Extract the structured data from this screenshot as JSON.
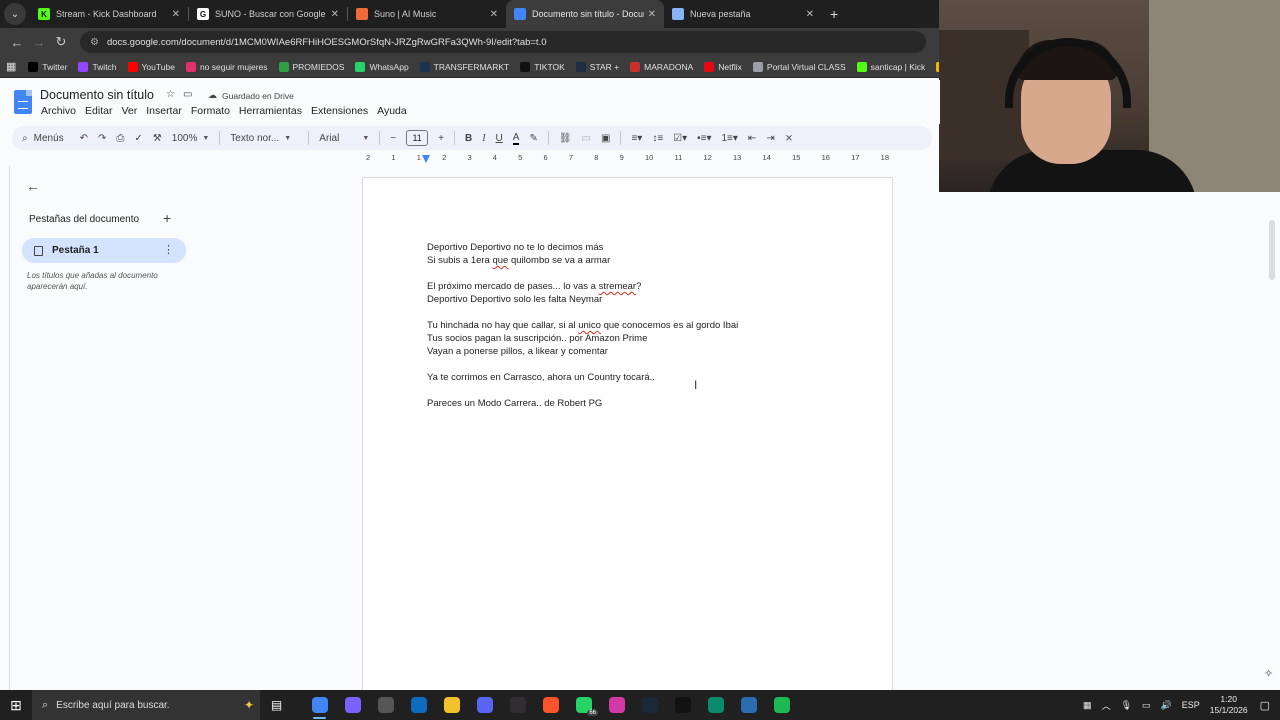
{
  "browser": {
    "tabs": [
      {
        "title": "Stream - Kick Dashboard",
        "favicon_color": "#53fc18",
        "favicon_glyph": "K",
        "active": false
      },
      {
        "title": "SUNO - Buscar con Google",
        "favicon_color": "#ffffff",
        "favicon_glyph": "G",
        "active": false
      },
      {
        "title": "Suno | AI Music",
        "favicon_color": "#f06a3c",
        "favicon_glyph": "",
        "active": false
      },
      {
        "title": "Documento sin título - Docume",
        "favicon_color": "#4285f4",
        "favicon_glyph": "",
        "active": true
      },
      {
        "title": "Nueva pestaña",
        "favicon_color": "#8ab4f8",
        "favicon_glyph": "",
        "active": false
      }
    ],
    "url": "docs.google.com/document/d/1MCM0WIAe6RFHiHOESGMOrSfqN-JRZgRwGRFa3QWh-9I/edit?tab=t.0",
    "bookmarks": [
      {
        "label": "Twitter",
        "color": "#000000"
      },
      {
        "label": "Twitch",
        "color": "#9146ff"
      },
      {
        "label": "YouTube",
        "color": "#ff0000"
      },
      {
        "label": "no seguir mujeres",
        "color": "#e1306c"
      },
      {
        "label": "PROMIEDOS",
        "color": "#2e9e44"
      },
      {
        "label": "WhatsApp",
        "color": "#25d366"
      },
      {
        "label": "TRANSFERMARKT",
        "color": "#1a3151"
      },
      {
        "label": "TIKTOK",
        "color": "#111111"
      },
      {
        "label": "STAR +",
        "color": "#1f2a44"
      },
      {
        "label": "MARADONA",
        "color": "#c4302b"
      },
      {
        "label": "Netflix",
        "color": "#e50914"
      },
      {
        "label": "Portal Virtual CLASS",
        "color": "#9aa0a6"
      },
      {
        "label": "santicap | Kick",
        "color": "#53fc18"
      },
      {
        "label": "UDE",
        "color": "#f4b400"
      }
    ]
  },
  "docs": {
    "title": "Documento sin título",
    "saved_status": "Guardado en Drive",
    "menu": [
      "Archivo",
      "Editar",
      "Ver",
      "Insertar",
      "Formato",
      "Herramientas",
      "Extensiones",
      "Ayuda"
    ],
    "toolbar": {
      "menus_label": "Menús",
      "zoom": "100%",
      "style": "Texto nor...",
      "font": "Arial",
      "font_size": "11"
    },
    "ruler_numbers": [
      "2",
      "1",
      "1",
      "2",
      "3",
      "4",
      "5",
      "6",
      "7",
      "8",
      "9",
      "10",
      "11",
      "12",
      "13",
      "14",
      "15",
      "16",
      "17",
      "18"
    ],
    "left_panel": {
      "heading": "Pestañas del documento",
      "tab_name": "Pestaña 1",
      "hint": "Los títulos que añadas al documento aparecerán aquí."
    },
    "lines": [
      "Deportivo Deportivo no te lo decimos más",
      "Si subis a 1era que quilombo se va a armar",
      "",
      "El próximo mercado de pases... lo vas a stremear?",
      "Deportivo Deportivo solo les falta Neymar",
      "",
      "Tu hinchada no hay que callar, si al unico que conocemos es al gordo Ibai",
      "Tus socios pagan la suscripción.. por Amazon Prime",
      "Vayan a ponerse pillos, a likear y comentar",
      "",
      "Ya te corrimos en Carrasco, ahora un Country tocará..",
      "",
      "Pareces un Modo Carrera.. de Robert PG"
    ]
  },
  "taskbar": {
    "search_placeholder": "Escribe aquí para buscar.",
    "apps": [
      {
        "name": "chrome",
        "color": "#4285f4",
        "active": true,
        "badge": ""
      },
      {
        "name": "copilot",
        "color": "#7b61ff",
        "active": false,
        "badge": ""
      },
      {
        "name": "cpuz",
        "color": "#555555",
        "active": false,
        "badge": ""
      },
      {
        "name": "mail",
        "color": "#0f6cbd",
        "active": false,
        "badge": ""
      },
      {
        "name": "explorer",
        "color": "#f3c12b",
        "active": false,
        "badge": ""
      },
      {
        "name": "discord",
        "color": "#5865f2",
        "active": false,
        "badge": ""
      },
      {
        "name": "obs",
        "color": "#302e31",
        "active": false,
        "badge": ""
      },
      {
        "name": "brave",
        "color": "#fb542b",
        "active": false,
        "badge": ""
      },
      {
        "name": "whatsapp",
        "color": "#25d366",
        "active": false,
        "badge": "66"
      },
      {
        "name": "app-pink",
        "color": "#d13aa5",
        "active": false,
        "badge": ""
      },
      {
        "name": "steam",
        "color": "#1b2838",
        "active": false,
        "badge": ""
      },
      {
        "name": "capcut",
        "color": "#111111",
        "active": false,
        "badge": ""
      },
      {
        "name": "terminal",
        "color": "#0b8a6c",
        "active": false,
        "badge": ""
      },
      {
        "name": "vpn",
        "color": "#2b6cb0",
        "active": false,
        "badge": ""
      },
      {
        "name": "spotify",
        "color": "#1db954",
        "active": false,
        "badge": ""
      }
    ],
    "language": "ESP",
    "time": "1:20",
    "date": "15/1/2026"
  }
}
